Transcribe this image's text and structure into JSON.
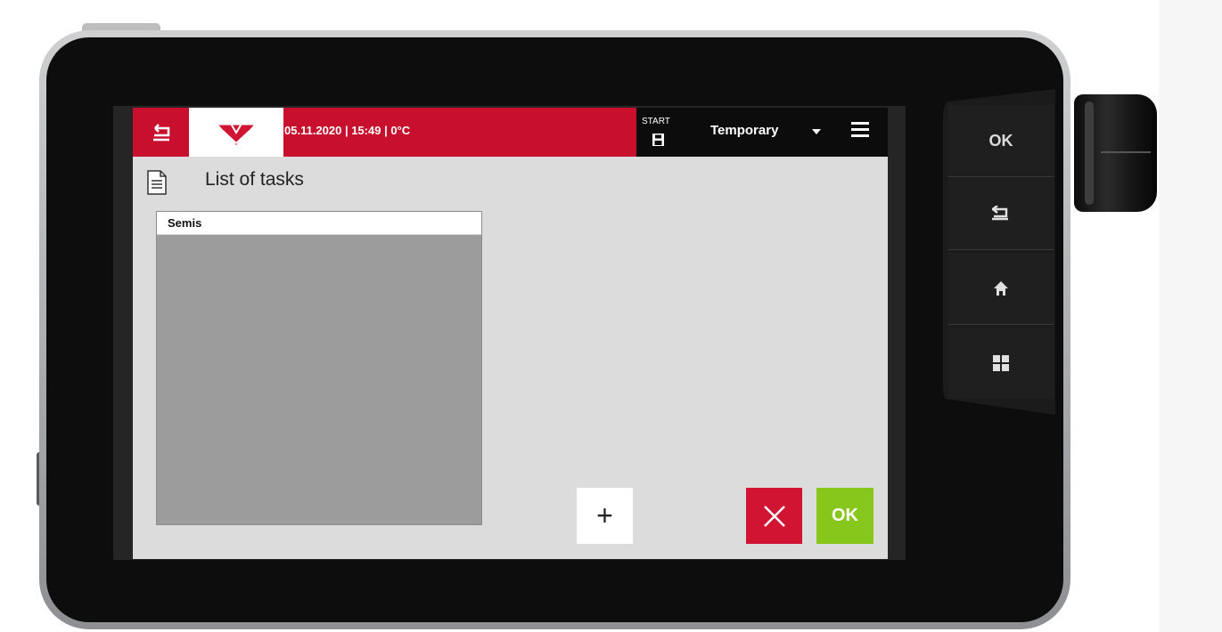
{
  "status_bar": {
    "datetime": "05.11.2020 | 15:49 | 0°C",
    "start_label": "START",
    "profile_label": "Temporary"
  },
  "page": {
    "title": "List of tasks"
  },
  "task_list": {
    "items": [
      "Semis"
    ]
  },
  "actions": {
    "add_label": "+",
    "ok_label": "OK"
  },
  "hardware_buttons": {
    "ok_label": "OK"
  },
  "colors": {
    "brand_red": "#c8102e",
    "cancel_red": "#d21433",
    "ok_green": "#87c71b"
  },
  "icons": [
    "back-icon",
    "brand-logo",
    "save-icon",
    "dropdown-icon",
    "menu-icon",
    "document-icon",
    "close-icon",
    "home-icon",
    "grid-icon"
  ]
}
